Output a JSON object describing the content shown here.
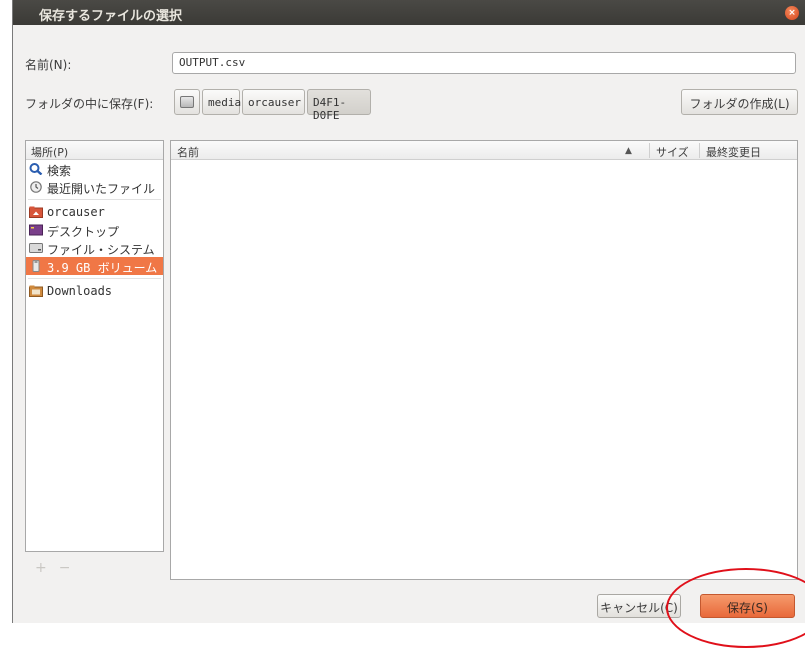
{
  "window": {
    "title": "保存するファイルの選択",
    "close_glyph": "×"
  },
  "name_row": {
    "label": "名前(N):",
    "value": "OUTPUT.csv"
  },
  "folder_row": {
    "label": "フォルダの中に保存(F):",
    "path": [
      "media",
      "orcauser",
      "D4F1-D0FE"
    ],
    "create_folder": "フォルダの作成(L)"
  },
  "places": {
    "header": "場所(P)",
    "items": [
      {
        "label": "検索",
        "icon": "search-icon"
      },
      {
        "label": "最近開いたファイル",
        "icon": "recent-icon"
      },
      {
        "label": "orcauser",
        "icon": "home-folder-icon"
      },
      {
        "label": "デスクトップ",
        "icon": "desktop-icon"
      },
      {
        "label": "ファイル・システム",
        "icon": "drive-icon"
      },
      {
        "label": "3.9 GB ボリューム",
        "icon": "usb-drive-icon",
        "selected": true
      },
      {
        "label": "Downloads",
        "icon": "folder-icon"
      }
    ],
    "add_glyph": "+",
    "remove_glyph": "−"
  },
  "files": {
    "columns": [
      "名前",
      "サイズ",
      "最終変更日"
    ],
    "sort_indicator": "▲",
    "rows": []
  },
  "buttons": {
    "cancel": "キャンセル(C)",
    "save": "保存(S)"
  },
  "colors": {
    "accent": "#f07746",
    "titlebar": "#3c3b37",
    "annotation_circle": "#e0101a"
  }
}
